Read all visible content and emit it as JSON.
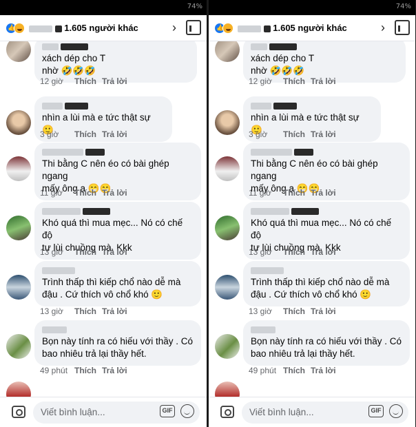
{
  "status": {
    "battery": "74%"
  },
  "header": {
    "reactions_label": "1.605 người khác",
    "reactions": [
      "like-icon",
      "haha-icon"
    ]
  },
  "comments": [
    {
      "text": "xách dép cho T\nnhờ 🤣🤣🤣",
      "time": "12 giờ",
      "like": "Thích",
      "reply": "Trả lời"
    },
    {
      "text": "nhìn a lùi mà e tức thật sự 🙂",
      "time": "3 giờ",
      "like": "Thích",
      "reply": "Trả lời"
    },
    {
      "text": "Thi bằng C nên éo có bài ghép ngang\nmấy ông ạ 😁😁",
      "time": "11 giờ",
      "like": "Thích",
      "reply": "Trả lời"
    },
    {
      "text": "Khó quá thì mua mẹc... Nó có chế độ\ntự lùi chuồng mà. Kkk",
      "time": "13 giờ",
      "like": "Thích",
      "reply": "Trả lời"
    },
    {
      "text": "Trình thấp thì kiếp chổ nào dễ mà\nđậu . Cứ thích vô chổ khó 🙂",
      "time": "13 giờ",
      "like": "Thích",
      "reply": "Trả lời"
    },
    {
      "text": "Bọn này tính ra có hiếu với thầy . Có\nbao nhiêu trả lại thầy hết.",
      "time": "49 phút",
      "like": "Thích",
      "reply": "Trả lời"
    }
  ],
  "composer": {
    "placeholder": "Viết bình luận...",
    "gif_label": "GIF"
  },
  "colors": {
    "bubble": "#f0f2f5",
    "like_blue": "#1877f2",
    "meta_gray": "#65676b"
  }
}
